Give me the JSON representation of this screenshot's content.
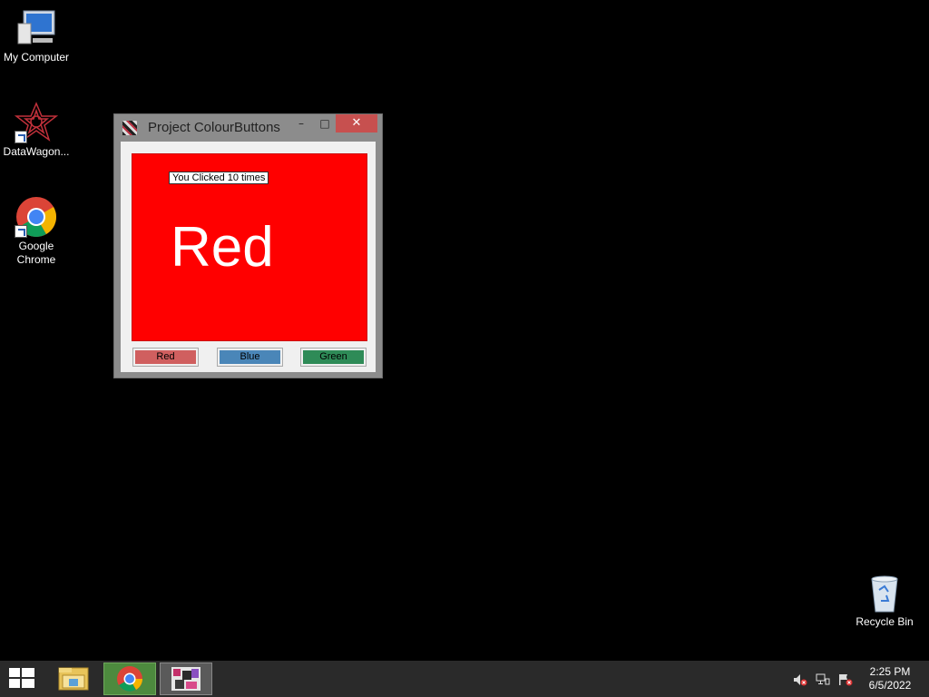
{
  "desktop": {
    "icons": [
      {
        "label": "My Computer"
      },
      {
        "label": "DataWagon..."
      },
      {
        "label": "Google\nChrome"
      },
      {
        "label": "Recycle Bin"
      }
    ]
  },
  "window": {
    "title": "Project ColourButtons",
    "minimize_symbol": "–",
    "maximize_symbol": "□",
    "close_symbol": "✕",
    "click_label": "You Clicked 10 times",
    "colour_text": "Red",
    "panel_color": "#ff0000",
    "buttons": [
      {
        "label": "Red",
        "color": "#d05f5f"
      },
      {
        "label": "Blue",
        "color": "#4a86b8"
      },
      {
        "label": "Green",
        "color": "#2e8b57"
      }
    ]
  },
  "taskbar": {
    "items": [
      "windows-start-icon",
      "file-explorer-icon",
      "chrome-icon",
      "colourbuttons-app-icon"
    ],
    "tray": [
      "speaker-muted-icon",
      "network-icon",
      "action-center-flag-icon"
    ],
    "time": "2:25 PM",
    "date": "6/5/2022"
  }
}
